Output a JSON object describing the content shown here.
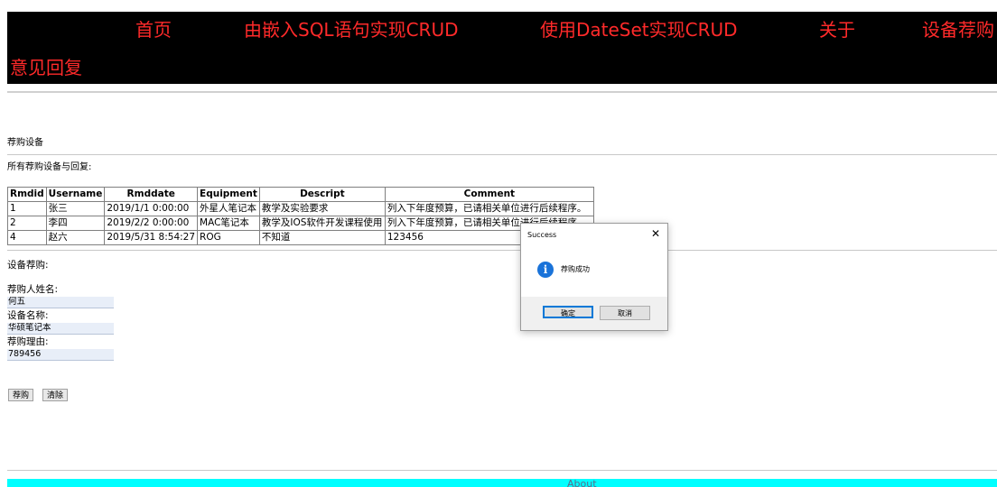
{
  "nav": {
    "items": [
      "首页",
      "由嵌入SQL语句实现CRUD",
      "使用DateSet实现CRUD",
      "关于",
      "设备荐购",
      "意见回复"
    ]
  },
  "section": {
    "heading": "荐购设备",
    "list_caption": "所有荐购设备与回复:"
  },
  "table": {
    "headers": [
      "Rmdid",
      "Username",
      "Rmddate",
      "Equipment",
      "Descript",
      "Comment"
    ],
    "rows": [
      [
        "1",
        "张三",
        "2019/1/1 0:00:00",
        "外星人笔记本",
        "教学及实验要求",
        "列入下年度预算，已请相关单位进行后续程序。"
      ],
      [
        "2",
        "李四",
        "2019/2/2 0:00:00",
        "MAC笔记本",
        "教学及IOS软件开发课程使用",
        "列入下年度预算，已请相关单位进行后续程序。"
      ],
      [
        "4",
        "赵六",
        "2019/5/31 8:54:27",
        "ROG",
        "不知道",
        "123456"
      ]
    ]
  },
  "form": {
    "title": "设备荐购:",
    "name_label": "荐购人姓名:",
    "name_value": "何五",
    "equipment_label": "设备名称:",
    "equipment_value": "华硕笔记本",
    "reason_label": "荐购理由:",
    "reason_value": "789456",
    "submit_label": "荐购",
    "clear_label": "清除"
  },
  "footer": {
    "text": "About"
  },
  "dialog": {
    "title": "Success",
    "close_glyph": "✕",
    "icon_glyph": "i",
    "message": "荐购成功",
    "ok_label": "确定",
    "cancel_label": "取消",
    "accent_color": "#0078d7"
  },
  "colors": {
    "nav_bg": "#000000",
    "nav_text": "#ff2a2a",
    "footer_bg": "#00ffff",
    "info_icon": "#1a73d9"
  }
}
